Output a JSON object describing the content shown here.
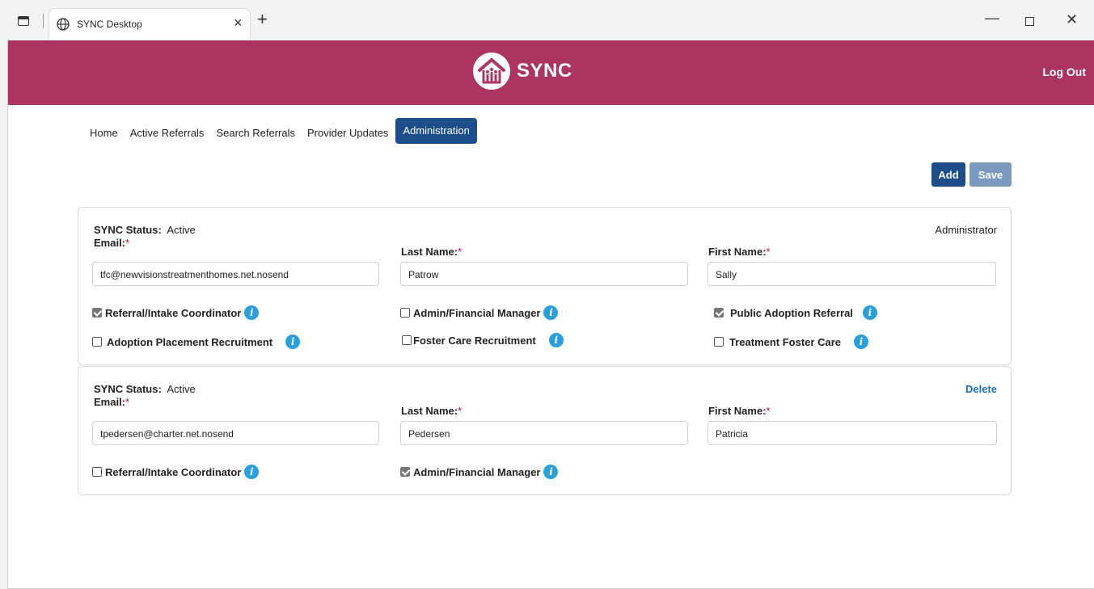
{
  "browser": {
    "tab_title": "SYNC Desktop",
    "tab_close": "×",
    "new_tab": "+",
    "min": "—",
    "close": "✕"
  },
  "header": {
    "app_name": "SYNC",
    "logout": "Log Out",
    "color": "#ab3461"
  },
  "nav": {
    "items": [
      "Home",
      "Active Referrals",
      "Search Referrals",
      "Provider Updates",
      "Administration"
    ],
    "active": "Administration"
  },
  "actions": {
    "add": "Add",
    "save": "Save"
  },
  "users": [
    {
      "status_label": "SYNC Status:",
      "status_value": "Active",
      "corner": "Administrator",
      "email_label": "Email:",
      "email": "tfc@newvisionstreatmenthomes.net.nosend",
      "last_label": "Last Name:",
      "last_name": "Patrow",
      "first_label": "First Name:",
      "first_name": "Sally",
      "roles": [
        {
          "label": "Referral/Intake Coordinator",
          "checked": true
        },
        {
          "label": "Admin/Financial Manager",
          "checked": false
        },
        {
          "label": "Public Adoption Referral",
          "checked": true
        },
        {
          "label": "Adoption Placement Recruitment",
          "checked": false
        },
        {
          "label": "Foster Care Recruitment",
          "checked": false
        },
        {
          "label": "Treatment Foster Care",
          "checked": false
        }
      ]
    },
    {
      "status_label": "SYNC Status:",
      "status_value": "Active",
      "corner": "Delete",
      "email_label": "Email:",
      "email": "tpedersen@charter.net.nosend",
      "last_label": "Last Name:",
      "last_name": "Pedersen",
      "first_label": "First Name:",
      "first_name": "Patricia",
      "roles": [
        {
          "label": "Referral/Intake Coordinator",
          "checked": false
        },
        {
          "label": "Admin/Financial Manager",
          "checked": true
        }
      ]
    }
  ],
  "required_mark": "*",
  "info_glyph": "i"
}
